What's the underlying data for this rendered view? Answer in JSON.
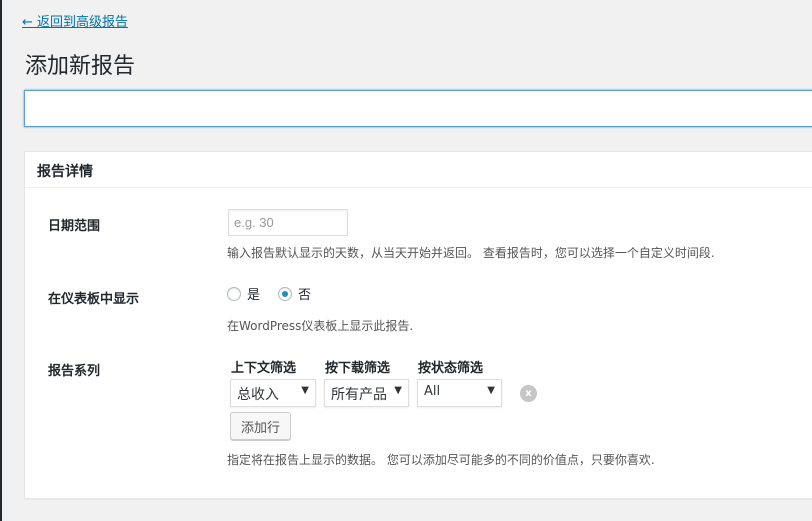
{
  "nav": {
    "back_link": "← 返回到高级报告"
  },
  "page": {
    "title": "添加新报告",
    "title_input_value": ""
  },
  "panel": {
    "heading": "报告详情"
  },
  "fields": {
    "date_range": {
      "label": "日期范围",
      "placeholder": "e.g. 30",
      "value": "",
      "description": "输入报告默认显示的天数，从当天开始并返回。 查看报告时，您可以选择一个自定义时间段."
    },
    "dashboard": {
      "label": "在仪表板中显示",
      "options": [
        {
          "label": "是",
          "checked": false
        },
        {
          "label": "否",
          "checked": true
        }
      ],
      "description": "在WordPress仪表板上显示此报告."
    },
    "series": {
      "label": "报告系列",
      "columns": [
        "上下文筛选",
        "按下载筛选",
        "按状态筛选"
      ],
      "row": {
        "context": "总收入",
        "download": "所有产品",
        "status": "All"
      },
      "remove_icon": "x",
      "add_row": "添加行",
      "description": "指定将在报告上显示的数据。 您可以添加尽可能多的不同的价值点，只要你喜欢."
    }
  }
}
